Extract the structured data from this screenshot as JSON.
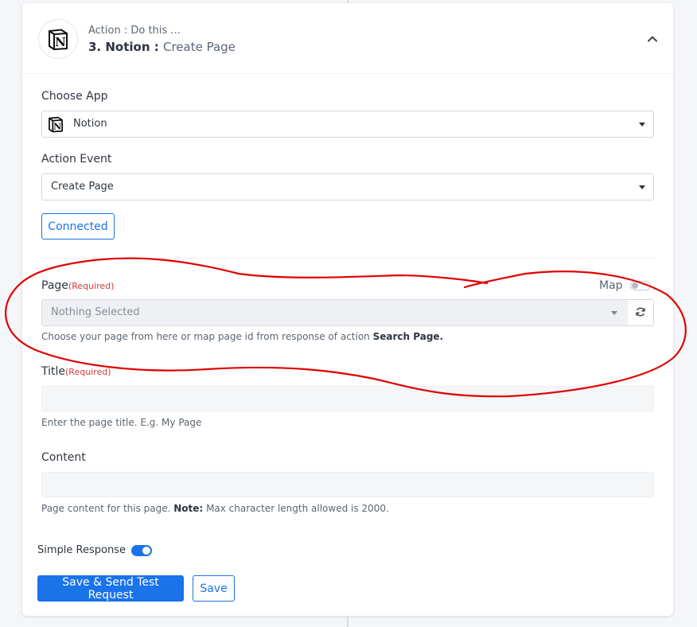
{
  "header": {
    "kicker": "Action : Do this ...",
    "title": "3. Notion :",
    "subtitle": "Create Page"
  },
  "choose_app": {
    "label": "Choose App",
    "selected": "Notion"
  },
  "action_event": {
    "label": "Action Event",
    "selected": "Create Page"
  },
  "connected_button": "Connected",
  "page_field": {
    "label": "Page",
    "required": "(Required)",
    "map_label": "Map",
    "placeholder": "Nothing Selected",
    "help_prefix": "Choose your page from here or map page id from response of action",
    "help_bold": "Search Page."
  },
  "title_field": {
    "label": "Title",
    "required": "(Required)",
    "help": "Enter the page title. E.g. My Page"
  },
  "content_field": {
    "label": "Content",
    "help_prefix": "Page content for this page.",
    "help_bold": "Note:",
    "help_suffix": "Max character length allowed is 2000."
  },
  "simple_response": {
    "label": "Simple Response",
    "enabled": true
  },
  "buttons": {
    "save_send": "Save & Send Test Request",
    "save": "Save"
  },
  "colors": {
    "accent": "#1a73e8",
    "required": "#d03b3b",
    "annotation": "#e00000"
  },
  "icons": {
    "app_logo": "notion-logo-icon",
    "collapse": "chevron-up-icon",
    "refresh": "refresh-icon"
  }
}
